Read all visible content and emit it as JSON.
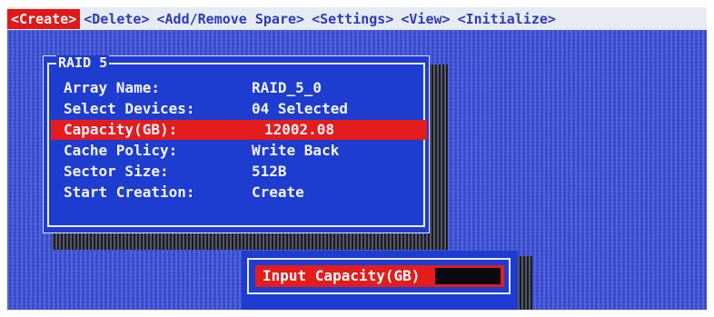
{
  "menu": {
    "items": [
      "<Create>",
      "<Delete>",
      "<Add/Remove Spare>",
      "<Settings>",
      "<View>",
      "<Initialize>"
    ]
  },
  "raid_panel": {
    "title": "RAID 5",
    "rows": [
      {
        "label": "Array Name:",
        "value": "RAID_5_0"
      },
      {
        "label": "Select Devices:",
        "value": "04 Selected"
      },
      {
        "label": "Capacity(GB):",
        "value": "12002.08"
      },
      {
        "label": "Cache Policy:",
        "value": "Write Back"
      },
      {
        "label": "Sector Size:",
        "value": "512B"
      },
      {
        "label": "Start Creation:",
        "value": "Create"
      }
    ]
  },
  "input_dialog": {
    "label": "Input Capacity(GB)",
    "value": ""
  },
  "colors": {
    "background": "#3d4fcf",
    "panel": "#1e3ccf",
    "highlight": "#e41c1c",
    "menubar": "#e8ebf3",
    "menu_text": "#2a3cb8"
  }
}
